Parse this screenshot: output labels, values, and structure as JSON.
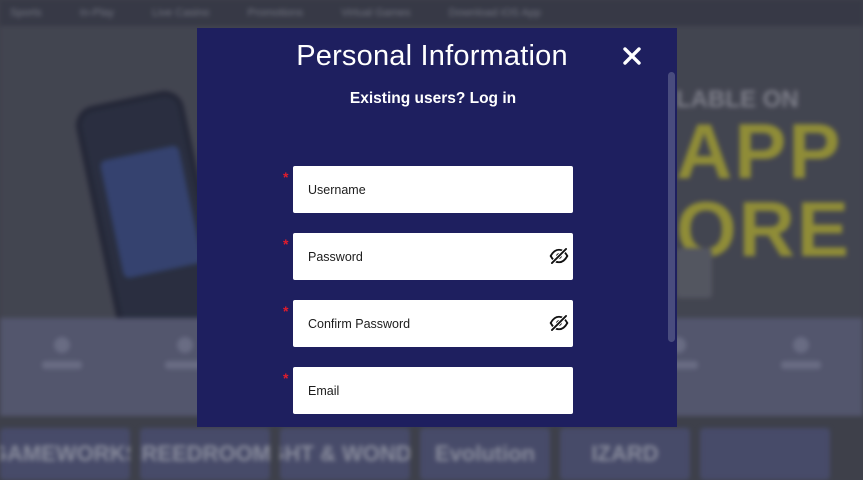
{
  "background": {
    "nav_items": [
      "Sports",
      "In-Play",
      "Live Casino",
      "Promotions",
      "Virtual Games",
      "Download iOS App"
    ],
    "app_promo": {
      "line1": "LABLE ON",
      "line2": "APP",
      "line3": "ORE"
    },
    "tiles": [
      "GAMEWORKS",
      "CREEDROOMZ",
      "LIGHT & WONDER",
      "Evolution",
      "IZARD",
      ""
    ]
  },
  "modal": {
    "title": "Personal Information",
    "close_icon": "close-icon",
    "existing_users_link": "Existing users? Log in",
    "required_marker": "*",
    "fields": [
      {
        "placeholder": "Username",
        "value": "",
        "icon": ""
      },
      {
        "placeholder": "Password",
        "value": "",
        "icon": "eye-slash-icon"
      },
      {
        "placeholder": "Confirm Password",
        "value": "",
        "icon": "eye-slash-icon"
      },
      {
        "placeholder": "Email",
        "value": "",
        "icon": ""
      }
    ]
  },
  "colors": {
    "modal_background": "#1e1f5f",
    "field_background": "#ffffff",
    "required_marker": "#e01c2c",
    "text_on_modal": "#ffffff"
  }
}
